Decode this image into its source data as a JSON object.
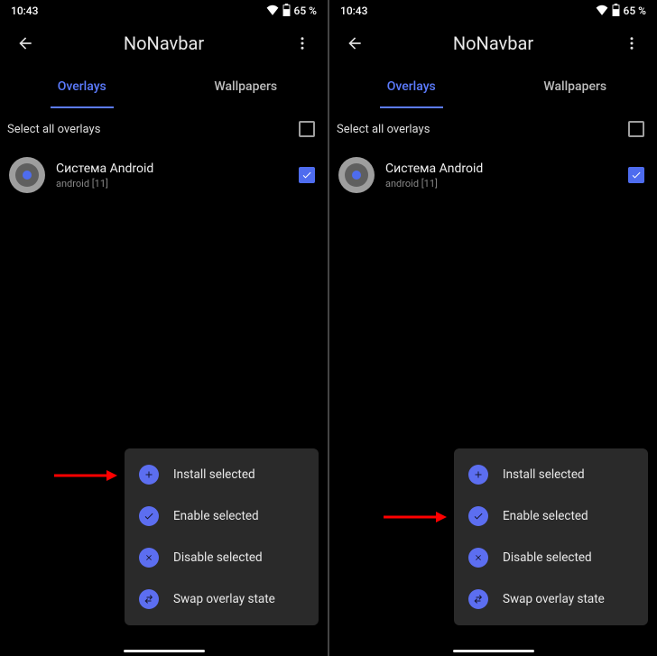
{
  "status": {
    "time": "10:43",
    "battery": "65 %"
  },
  "appbar": {
    "title": "NoNavbar"
  },
  "tabs": {
    "overlays": "Overlays",
    "wallpapers": "Wallpapers"
  },
  "selectAll": {
    "label": "Select all overlays"
  },
  "item": {
    "title": "Система Android",
    "sub": "android [11]"
  },
  "menu": {
    "install": "Install selected",
    "enable": "Enable selected",
    "disable": "Disable selected",
    "swap": "Swap overlay state"
  }
}
